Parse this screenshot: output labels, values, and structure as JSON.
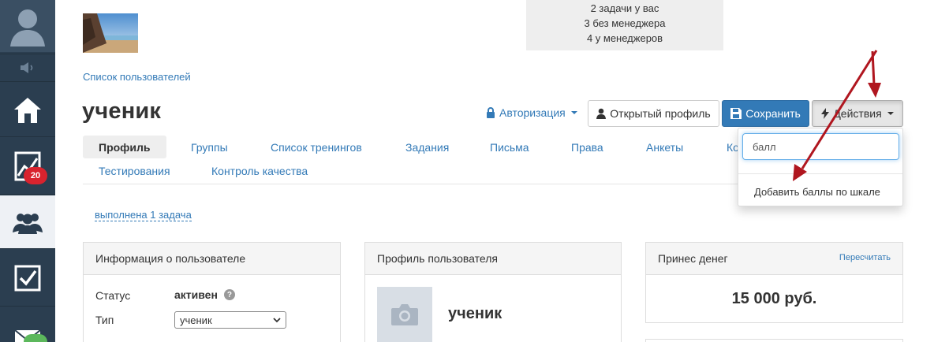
{
  "stats": {
    "line1": "2 задачи у вас",
    "line2": "3 без менеджера",
    "line3": "4 у менеджеров"
  },
  "sidebar": {
    "badge": "20"
  },
  "breadcrumb": "Список пользователей",
  "title": "ученик",
  "toolbar": {
    "auth_label": "Авторизация",
    "open_profile_label": "Открытый профиль",
    "save_label": "Сохранить",
    "actions_label": "Действия"
  },
  "tabs": [
    {
      "label": "Профиль",
      "active": true
    },
    {
      "label": "Группы"
    },
    {
      "label": "Список тренингов"
    },
    {
      "label": "Задания"
    },
    {
      "label": "Письма"
    },
    {
      "label": "Права"
    },
    {
      "label": "Анкеты"
    },
    {
      "label": "Ко"
    },
    {
      "label": "Тестирования"
    },
    {
      "label": "Контроль качества"
    }
  ],
  "tasks_done": "выполнена 1 задача",
  "user_info": {
    "header": "Информация о пользователе",
    "status_label": "Статус",
    "status_value": "активен",
    "type_label": "Тип",
    "type_value": "ученик"
  },
  "user_profile": {
    "header": "Профиль пользователя",
    "name": "ученик"
  },
  "money": {
    "header": "Принес денег",
    "recalc_label": "Пересчитать",
    "value": "15 000 руб."
  },
  "dropdown": {
    "search_value": "балл",
    "item": "Добавить баллы по шкале"
  },
  "colors": {
    "sidebar": "#2b3e50",
    "primary": "#337ab7",
    "badge": "#d9232e",
    "arrow": "#b0161f"
  }
}
